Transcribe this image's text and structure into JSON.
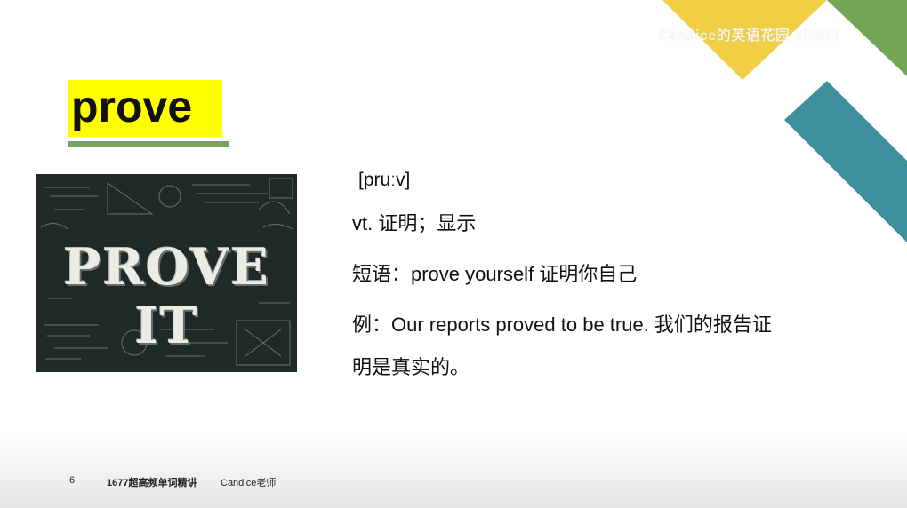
{
  "watermark": "Candice的英语花园 bilibili",
  "slide": {
    "word": "prove",
    "phonetic": "[pruːv]",
    "definition": "vt. 证明；显示",
    "phrase": "短语：prove yourself  证明你自己",
    "example_line1": "例：Our reports proved to be true. 我们的报告证",
    "example_line2": "明是真实的。",
    "image_text": "PROVE IT"
  },
  "footer": {
    "page_number": "6",
    "course": "1677超高频单词精讲",
    "teacher": "Candice老师"
  },
  "colors": {
    "word_highlight": "#ffff00",
    "underline": "#7aa35a",
    "deco_yellow": "#f0cf45",
    "deco_green": "#72a554",
    "deco_teal": "#3e8f9c",
    "chalkboard": "#1f2a28"
  }
}
